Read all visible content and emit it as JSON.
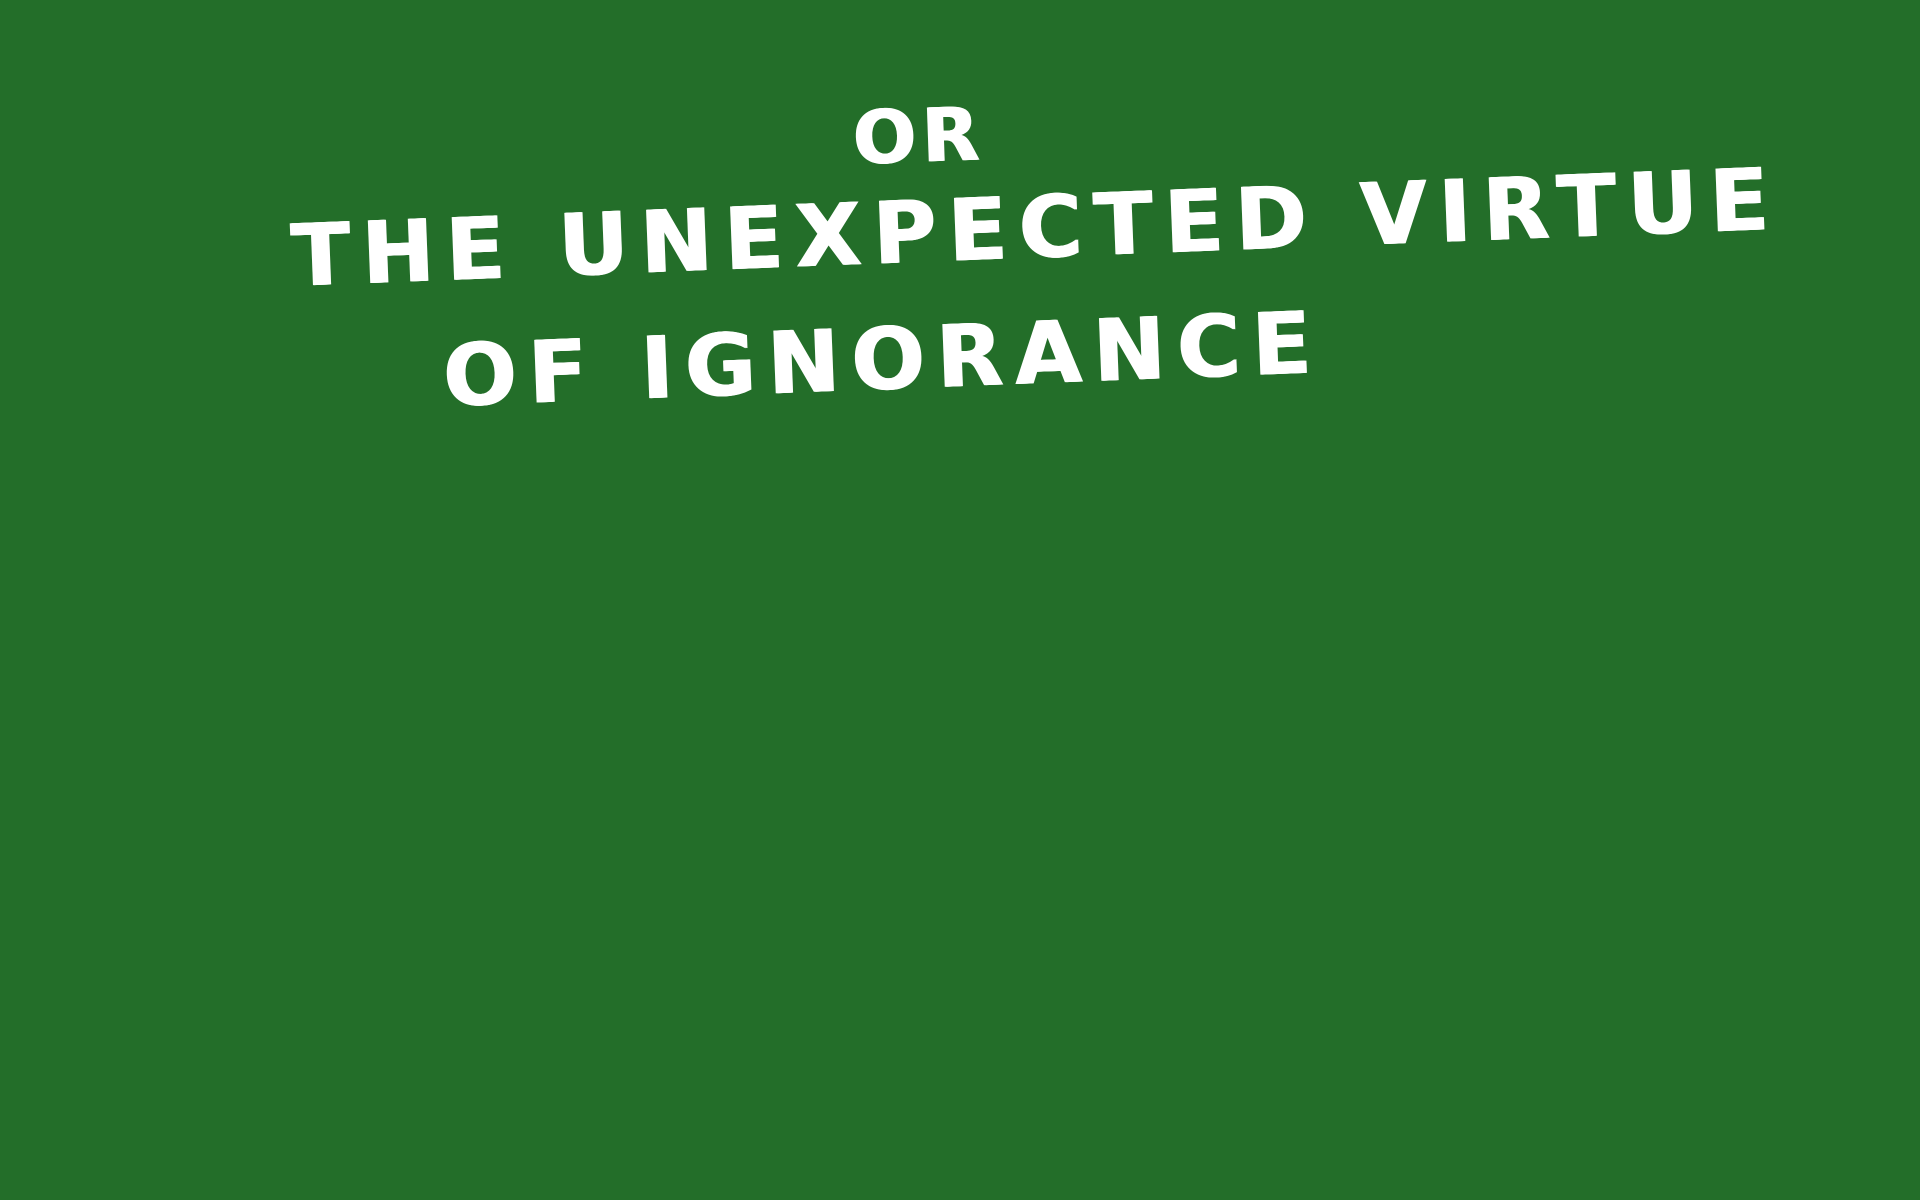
{
  "screen": {
    "background_color": "#236e29",
    "text_color": "#ffffff",
    "lines": [
      "OR",
      "THE UNEXPECTED VIRTUE",
      "OF IGNORANCE"
    ]
  }
}
